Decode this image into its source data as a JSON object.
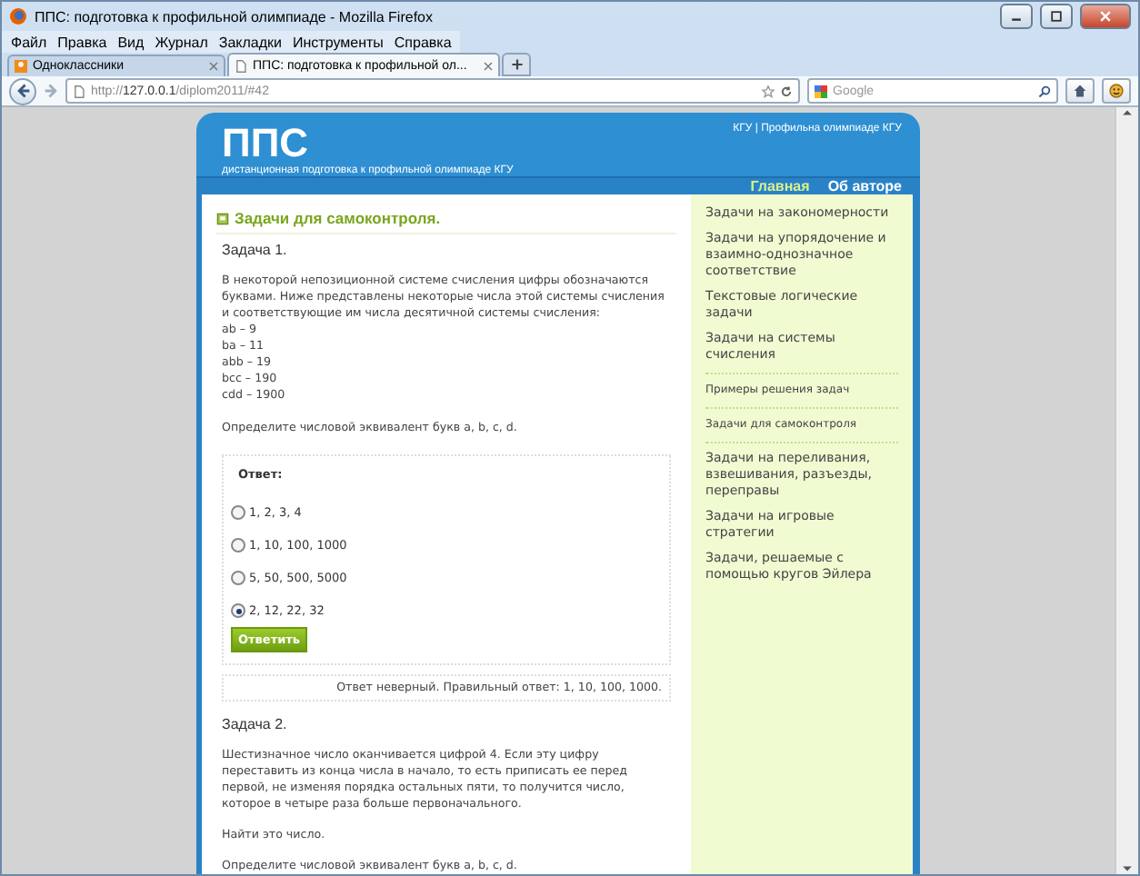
{
  "window": {
    "title": "ППС: подготовка к профильной олимпиаде - Mozilla Firefox"
  },
  "menu": [
    "Файл",
    "Правка",
    "Вид",
    "Журнал",
    "Закладки",
    "Инструменты",
    "Справка"
  ],
  "tabs": [
    {
      "label": "Одноклассники",
      "selected": false
    },
    {
      "label": "ППС: подготовка к профильной ол...",
      "selected": true
    }
  ],
  "address": {
    "url": "http://**127.0.0.1**/diplom2011/#42"
  },
  "search": {
    "placeholder": "Google"
  },
  "header": {
    "logo": "ППС",
    "subtitle": "дистанционная подготовка к профильной олимпиаде КГУ",
    "top_link": "КГУ | Профильна олимпиаде КГУ"
  },
  "nav": [
    {
      "label": "Главная",
      "selected": true
    },
    {
      "label": "Об авторе",
      "selected": false
    }
  ],
  "section_title": "Задачи для самоконтроля.",
  "task1": {
    "title": "Задача 1.",
    "text": "В некоторой непозиционной системе счисления цифры обозначаются буквами. Ниже представлены некоторые числа этой системы счисления и соответствующие им числа десятичной системы счисления:",
    "pairs": [
      "ab – 9",
      "ba – 11",
      "abb – 19",
      "bcc – 190",
      "cdd – 1900"
    ],
    "question": "Определите числовой эквивалент букв a, b, c, d."
  },
  "answer": {
    "label": "Ответ:",
    "options": [
      {
        "label": "1, 2, 3, 4",
        "selected": false
      },
      {
        "label": "1, 10, 100, 1000",
        "selected": false
      },
      {
        "label": "5, 50, 500, 5000",
        "selected": false
      },
      {
        "label": "2, 12, 22, 32",
        "selected": true
      }
    ],
    "button": "Ответить"
  },
  "feedback": "Ответ неверный. Правильный ответ: 1, 10, 100, 1000.",
  "task2": {
    "title": "Задача 2.",
    "text": "Шестизначное число оканчивается цифрой 4. Если эту цифру переставить из конца числа в начало, то есть приписать ее перед первой, не изменяя порядка остальных пяти, то получится число, которое в четыре раза больше первоначального.",
    "note": "Найти это число.",
    "question": "Определите числовой эквивалент букв a, b, c, d."
  },
  "sidebar": [
    {
      "label": "Задачи на закономерности",
      "kind": "main"
    },
    {
      "label": "Задачи на упорядочение и взаимно-однозначное соответствие",
      "kind": "main"
    },
    {
      "label": "Текстовые логические задачи",
      "kind": "main"
    },
    {
      "label": "Задачи на системы счисления",
      "kind": "main"
    },
    {
      "label": "Примеры решения задач",
      "kind": "sub"
    },
    {
      "label": "Задачи для самоконтроля",
      "kind": "sub"
    },
    {
      "label": "Задачи на переливания, взвешивания, разъезды, переправы",
      "kind": "main"
    },
    {
      "label": "Задачи на игровые стратегии",
      "kind": "main"
    },
    {
      "label": "Задачи, решаемые с помощью кругов Эйлера",
      "kind": "main"
    }
  ]
}
